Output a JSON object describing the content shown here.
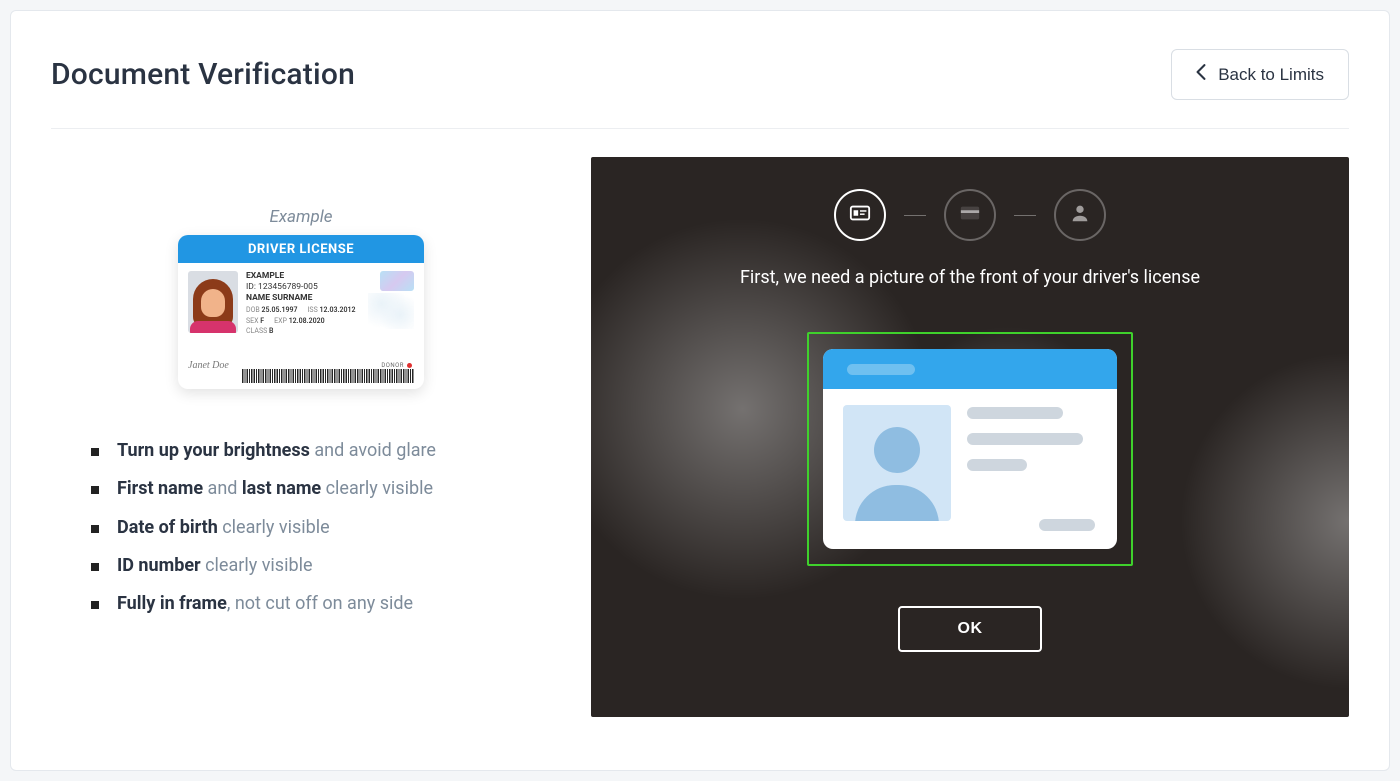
{
  "header": {
    "title": "Document Verification",
    "back_label": "Back to Limits"
  },
  "example": {
    "caption": "Example",
    "card": {
      "header": "DRIVER LICENSE",
      "sample_label": "EXAMPLE",
      "id_line": "ID: 123456789-005",
      "name_line": "NAME SURNAME",
      "dob_label": "DOB",
      "dob": "25.05.1997",
      "iss_label": "ISS",
      "iss": "12.03.2012",
      "sex_label": "SEX",
      "sex": "F",
      "exp_label": "EXP",
      "exp": "12.08.2020",
      "class_label": "CLASS",
      "class": "B",
      "signature": "Janet Doe",
      "donor": "DONOR"
    }
  },
  "tips": [
    {
      "b1": "Turn up your brightness",
      "t1": " and avoid glare"
    },
    {
      "b1": "First name",
      "t1": " and ",
      "b2": "last name",
      "t2": " clearly visible"
    },
    {
      "b1": "Date of birth",
      "t1": " clearly visible"
    },
    {
      "b1": "ID number",
      "t1": " clearly visible"
    },
    {
      "b1": "Fully in frame",
      "t1": ", not cut off on any side"
    }
  ],
  "camera": {
    "instruction": "First, we need a picture of the front of your driver's license",
    "ok_label": "OK"
  }
}
